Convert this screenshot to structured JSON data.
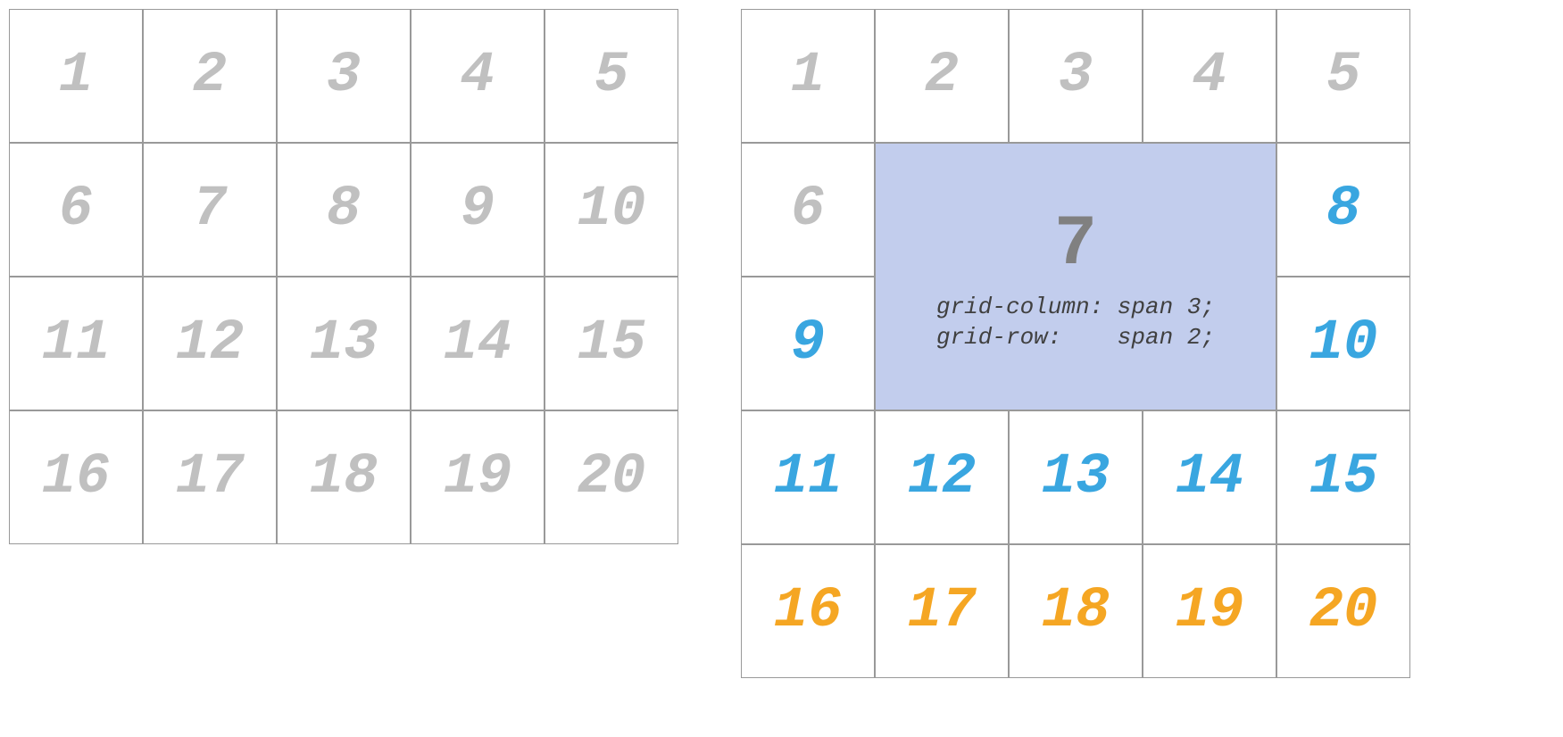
{
  "leftGrid": {
    "cells": [
      "1",
      "2",
      "3",
      "4",
      "5",
      "6",
      "7",
      "8",
      "9",
      "10",
      "11",
      "12",
      "13",
      "14",
      "15",
      "16",
      "17",
      "18",
      "19",
      "20"
    ]
  },
  "rightGrid": {
    "row1": [
      "1",
      "2",
      "3",
      "4",
      "5"
    ],
    "cell6": "6",
    "spanCell": {
      "number": "7",
      "codeLine1": "grid-column: span 3;",
      "codeLine2": "grid-row:    span 2;"
    },
    "cell8": "8",
    "cell9": "9",
    "cell10": "10",
    "row4": [
      "11",
      "12",
      "13",
      "14",
      "15"
    ],
    "row5": [
      "16",
      "17",
      "18",
      "19",
      "20"
    ]
  }
}
